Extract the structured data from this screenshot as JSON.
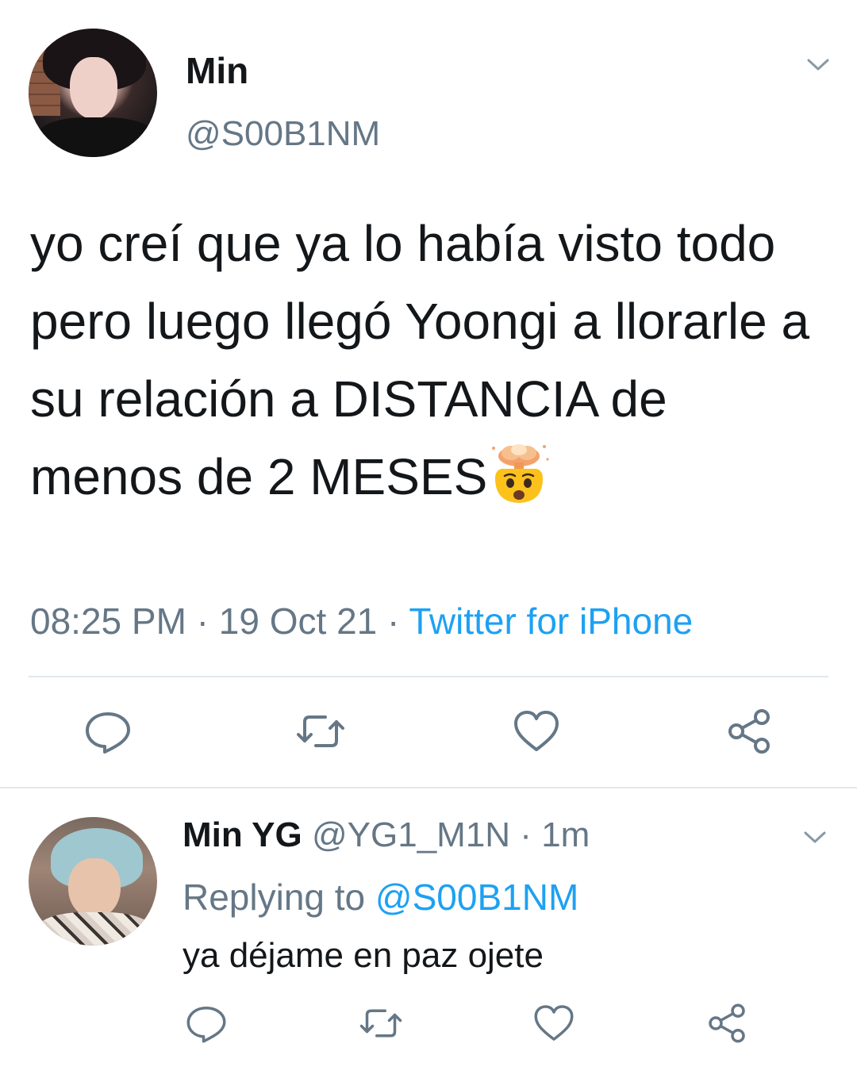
{
  "tweet": {
    "display_name": "Min",
    "handle": "@S00B1NM",
    "text": "yo creí que ya lo había visto todo pero luego llegó Yoongi a llorarle a su relación a DISTANCIA de menos de 2 MESES",
    "emoji": "exploding-head-emoji",
    "time": "08:25 PM",
    "separator": " · ",
    "date": "19 Oct 21",
    "source": "Twitter for iPhone"
  },
  "reply": {
    "display_name": "Min YG",
    "handle": "@YG1_M1N",
    "separator": " · ",
    "time": "1m",
    "replying_label": "Replying to",
    "replying_to": "@S00B1NM",
    "text": "ya déjame en paz ojete"
  },
  "icons": {
    "more": "chevron-down-icon",
    "reply": "comment-icon",
    "retweet": "retweet-icon",
    "like": "heart-icon",
    "share": "share-icon"
  },
  "colors": {
    "text_primary": "#14171a",
    "text_secondary": "#657786",
    "link": "#1da1f2",
    "divider": "#e1e8ed"
  }
}
